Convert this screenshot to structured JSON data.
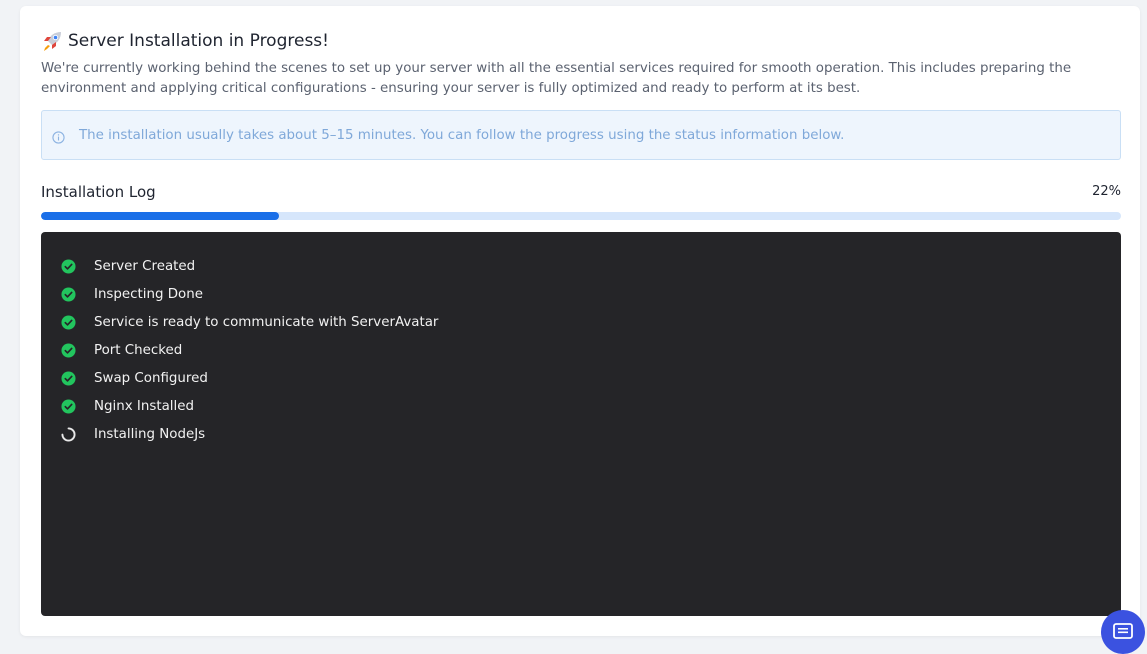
{
  "header": {
    "title": "Server Installation in Progress!",
    "description": "We're currently working behind the scenes to set up your server with all the essential services required for smooth operation. This includes preparing the environment and applying critical configurations - ensuring your server is fully optimized and ready to perform at its best."
  },
  "notice": {
    "icon": "info-icon",
    "text": "The installation usually takes about 5–15 minutes. You can follow the progress using the status information below."
  },
  "log": {
    "label": "Installation Log",
    "percent_label": "22%",
    "progress_percent": 22,
    "steps": [
      {
        "label": "Server Created",
        "status": "done"
      },
      {
        "label": "Inspecting Done",
        "status": "done"
      },
      {
        "label": "Service is ready to communicate with ServerAvatar",
        "status": "done"
      },
      {
        "label": "Port Checked",
        "status": "done"
      },
      {
        "label": "Swap Configured",
        "status": "done"
      },
      {
        "label": "Nginx Installed",
        "status": "done"
      },
      {
        "label": "Installing NodeJs",
        "status": "in-progress"
      }
    ]
  },
  "colors": {
    "accent": "#1a6fe8",
    "progress_track": "#d6e6fb",
    "terminal_bg": "#252528",
    "success": "#22c55e",
    "chat_button": "#3b52e0"
  },
  "chat": {
    "icon": "chat-icon"
  }
}
